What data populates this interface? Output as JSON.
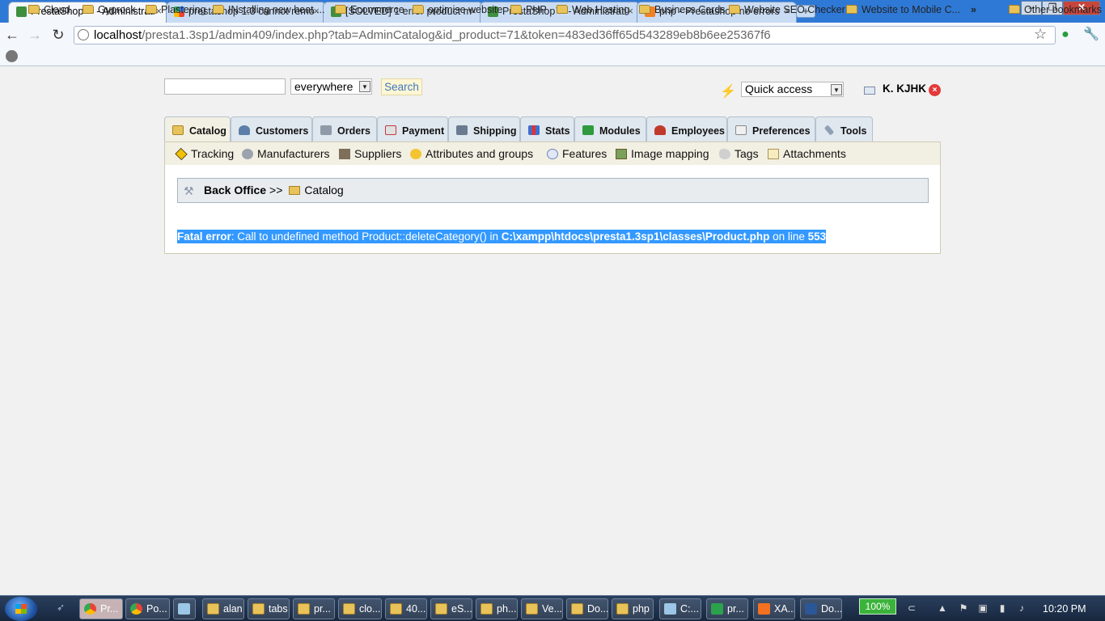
{
  "browser": {
    "tabs": [
      {
        "title": "PrestaShop™ - Administrati",
        "active": true,
        "favicon": "prestashop-icon"
      },
      {
        "title": "prestashop 1.3 cannot remo",
        "active": false,
        "favicon": "google-icon"
      },
      {
        "title": "[SOLVED] 1 error product m",
        "active": false,
        "favicon": "prestashop-icon"
      },
      {
        "title": "PrestaShop™ - Administrati",
        "active": false,
        "favicon": "prestashop-icon"
      },
      {
        "title": "php - Prestashop no errors",
        "active": false,
        "favicon": "stackoverflow-icon"
      }
    ],
    "new_tab_label": "+",
    "tab_close_glyph": "×",
    "url_host": "localhost",
    "url_path": "/presta1.3sp1/admin409/index.php?tab=AdminCatalog&id_product=71&token=483ed36ff65d543289eb8b6ee25367f6",
    "bookmarks": [
      "Cloud",
      "Gyprock",
      "Plastering",
      "INstalling new heat ...",
      "Ecommerce",
      "optimise website",
      "PHP",
      "Web Hosting",
      "Business Cards",
      "Website SEO Checker",
      "Website to Mobile C..."
    ],
    "bookmarks_overflow": "»",
    "other_bookmarks": "Other bookmarks"
  },
  "admin": {
    "search_placeholder": "",
    "search_scope": "everywhere",
    "search_button": "Search",
    "quick_access": "Quick access",
    "user_name": "K. KJHK",
    "tabs": [
      "Catalog",
      "Customers",
      "Orders",
      "Payment",
      "Shipping",
      "Stats",
      "Modules",
      "Employees",
      "Preferences",
      "Tools"
    ],
    "subtabs": [
      "Tracking",
      "Manufacturers",
      "Suppliers",
      "Attributes and groups",
      "Features",
      "Image mapping",
      "Tags",
      "Attachments"
    ],
    "breadcrumb": {
      "root": "Back Office",
      "separator": ">>",
      "current": "Catalog"
    },
    "error": {
      "label": "Fatal error",
      "message": ": Call to undefined method Product::deleteCategory() in ",
      "file": "C:\\xampp\\htdocs\\presta1.3sp1\\classes\\Product.php",
      "on_line": " on line ",
      "line": "553"
    }
  },
  "taskbar": {
    "items": [
      "Pr...",
      "Po...",
      "",
      "alan",
      "tabs",
      "pr...",
      "clo...",
      "40...",
      "eS...",
      "ph...",
      "Ve...",
      "Do...",
      "php",
      "C:...",
      "pr...",
      "XA...",
      "Do..."
    ],
    "battery": "100%",
    "time": "10:20 PM"
  }
}
